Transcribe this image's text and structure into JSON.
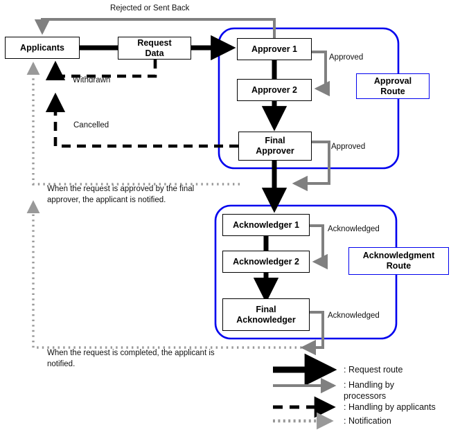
{
  "diagram": {
    "title": "Request approval and acknowledgment workflow",
    "colors": {
      "route_blue": "#0000ee",
      "request_black": "#000000",
      "processor_gray": "#808080",
      "notification_gray": "#999999",
      "box_border": "#000000",
      "background": "#ffffff"
    }
  },
  "nodes": {
    "applicants": "Applicants",
    "request_data": "Request\nData",
    "approver_1": "Approver 1",
    "approver_2": "Approver 2",
    "final_approver": "Final\nApprover",
    "acknowledger_1": "Acknowledger 1",
    "acknowledger_2": "Acknowledger 2",
    "final_acknowledger": "Final\nAcknowledger"
  },
  "route_labels": {
    "approval": "Approval\nRoute",
    "acknowledgment": "Acknowledgment\nRoute"
  },
  "edge_labels": {
    "rejected_or_sent_back": "Rejected or Sent Back",
    "withdrawn": "Withdrawn",
    "cancelled": "Cancelled",
    "approved_1": "Approved",
    "approved_final": "Approved",
    "acknowledged_1": "Acknowledged",
    "acknowledged_final": "Acknowledged"
  },
  "notes": {
    "approved_notification": "When the request is approved by the final approver, the applicant is notified.",
    "completed_notification": "When the request is completed, the applicant is notified."
  },
  "legend": {
    "items": [
      {
        "icon": "thick-black-arrow-icon",
        "label": ": Request route"
      },
      {
        "icon": "gray-arrow-icon",
        "label": ": Handling by processors"
      },
      {
        "icon": "dashed-black-arrow-icon",
        "label": ": Handling by applicants"
      },
      {
        "icon": "dotted-gray-arrow-icon",
        "label": ": Notification"
      }
    ]
  }
}
